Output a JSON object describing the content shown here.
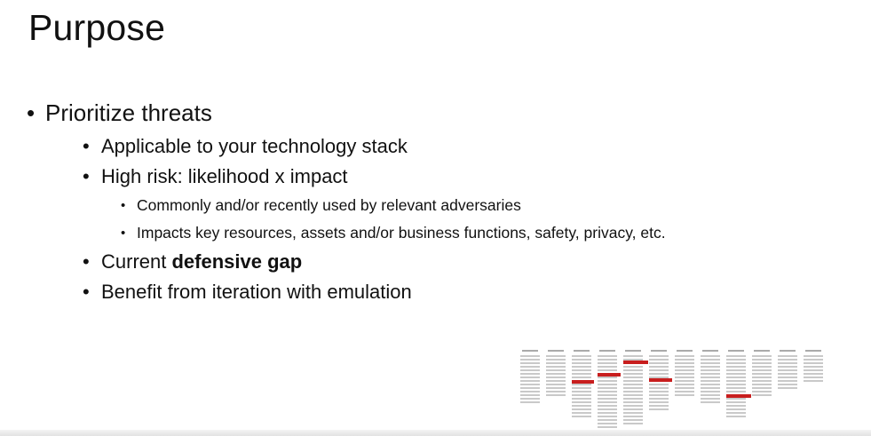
{
  "slide": {
    "title": "Purpose",
    "bullets": {
      "main": "Prioritize threats",
      "sub1": "Applicable to your technology stack",
      "sub2": "High risk: likelihood x impact",
      "sub2_items": [
        "Commonly and/or recently used by relevant adversaries",
        "Impacts key resources, assets and/or business functions, safety, privacy, etc."
      ],
      "sub3_prefix": "Current ",
      "sub3_bold": "defensive gap",
      "sub4": "Benefit from iteration with emulation"
    }
  },
  "colors": {
    "highlight_red": "#c81e1e"
  }
}
